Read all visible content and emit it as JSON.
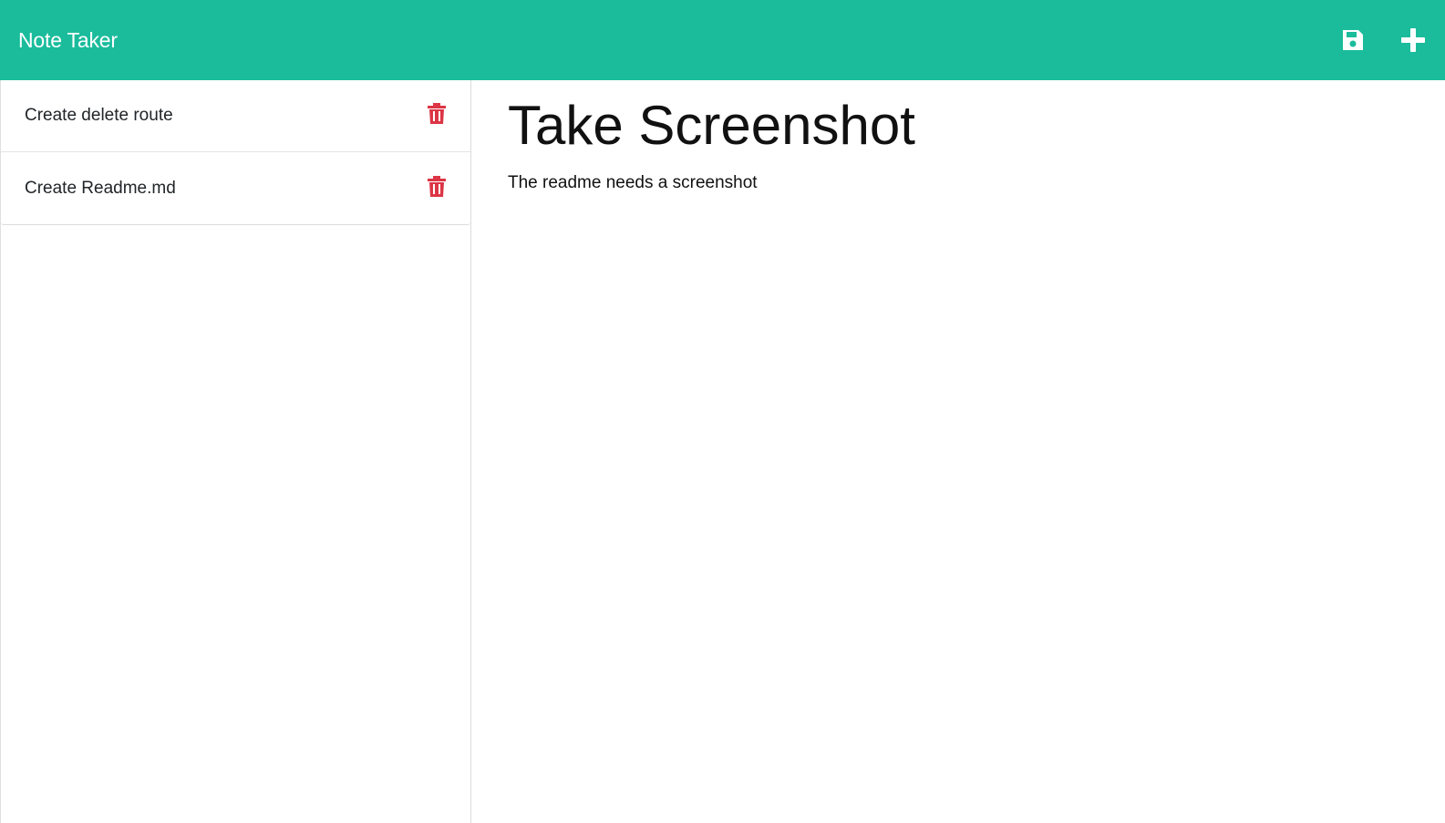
{
  "app": {
    "title": "Note Taker"
  },
  "navbar": {
    "save_icon": "save-icon",
    "new_icon": "plus-icon",
    "color": "#1abc9c"
  },
  "sidebar": {
    "notes": [
      {
        "title": "Create delete route",
        "icon": "trash-icon"
      },
      {
        "title": "Create Readme.md",
        "icon": "trash-icon"
      }
    ],
    "trash_color": "#dc3545"
  },
  "editor": {
    "title": "Take Screenshot",
    "body": "The readme needs a screenshot"
  }
}
